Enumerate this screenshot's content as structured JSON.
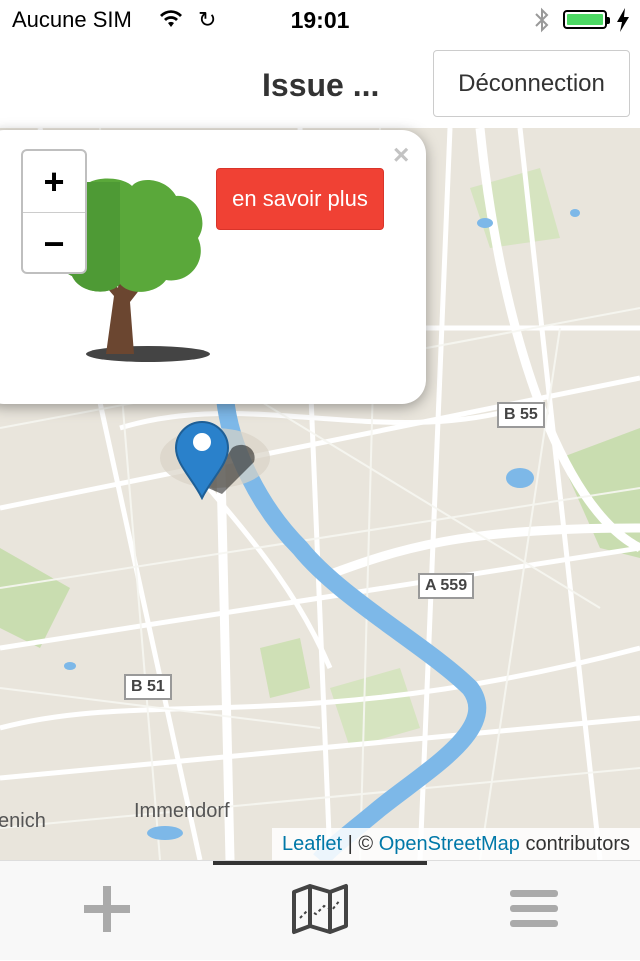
{
  "status_bar": {
    "carrier": "Aucune SIM",
    "time": "19:01",
    "icons": [
      "wifi-icon",
      "sync-icon",
      "bluetooth-icon",
      "battery-icon",
      "charging-icon"
    ]
  },
  "header": {
    "title": "Issue ...",
    "logout_label": "Déconnection"
  },
  "map": {
    "zoom_in_label": "+",
    "zoom_out_label": "−",
    "popup": {
      "close_label": "×",
      "button_label": "en savoir plus",
      "image": "tree-illustration"
    },
    "place_labels": [
      "Immendorf",
      "enich"
    ],
    "road_shields": [
      "B 55",
      "A 559",
      "B 51"
    ],
    "attribution": {
      "leaflet": "Leaflet",
      "separator": "| ©",
      "osm": "OpenStreetMap",
      "suffix": "contributors"
    },
    "colors": {
      "land": "#e9e5dc",
      "river": "#7db8e8",
      "park": "#c9ddb0",
      "marker": "#2a81cb",
      "button": "#f04134"
    }
  },
  "tabbar": {
    "tabs": [
      {
        "icon": "plus-icon"
      },
      {
        "icon": "map-icon",
        "active": true
      },
      {
        "icon": "menu-icon"
      }
    ]
  }
}
